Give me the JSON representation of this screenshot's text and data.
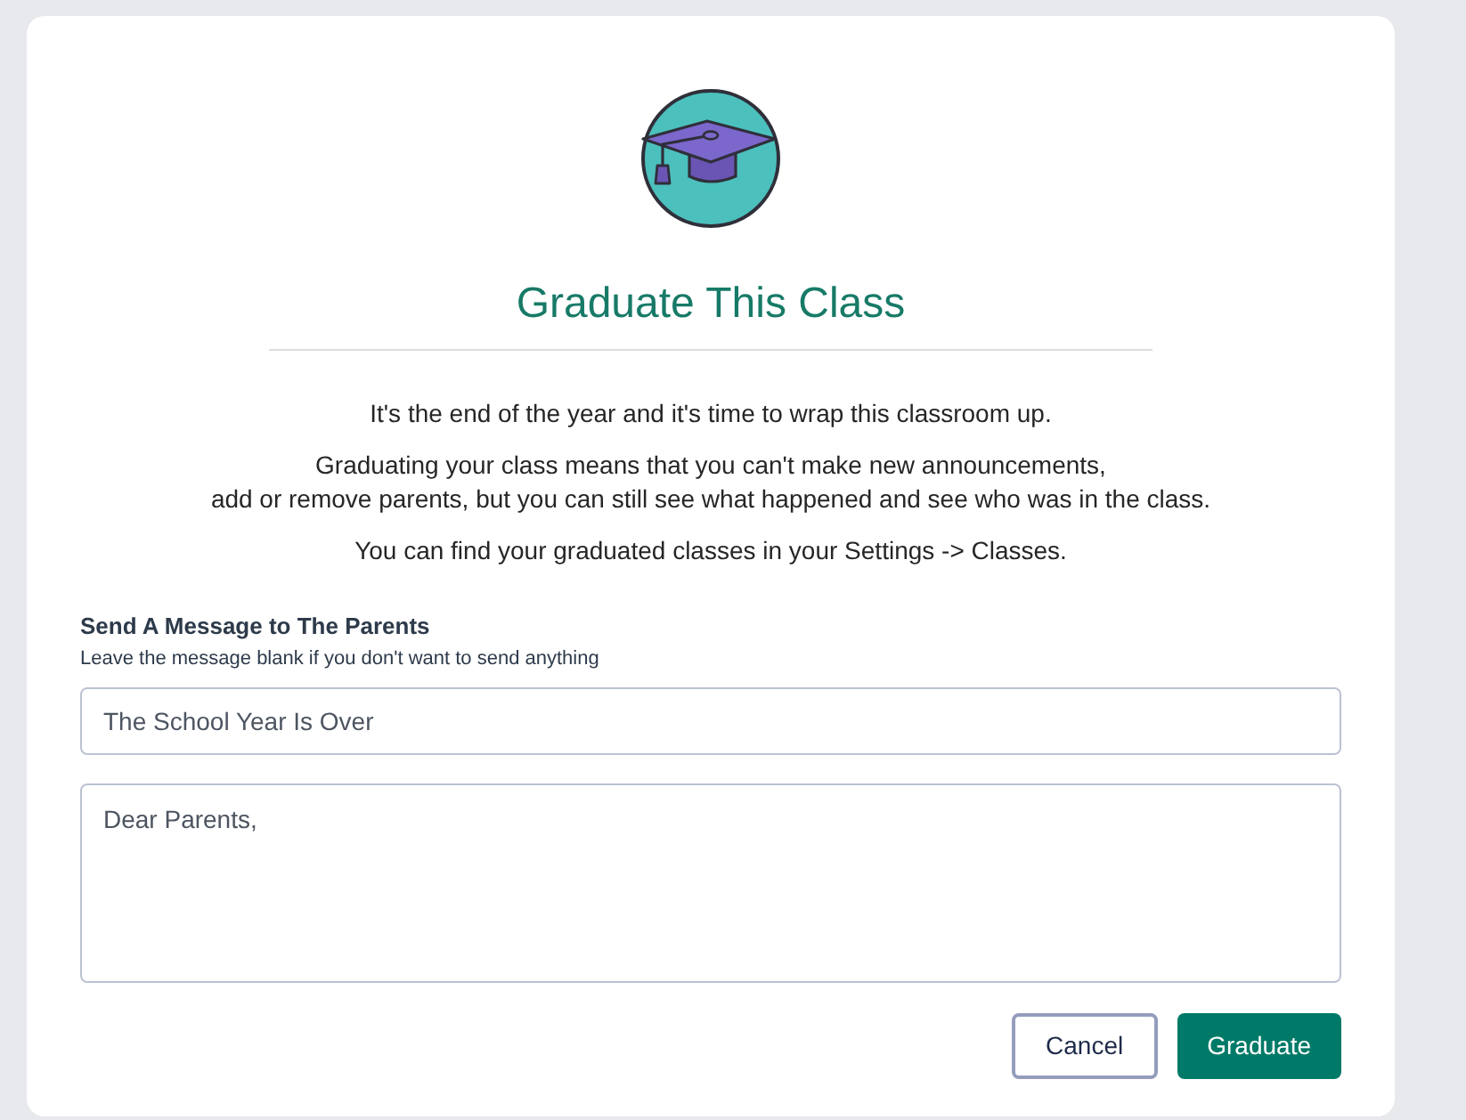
{
  "dialog": {
    "title": "Graduate This Class",
    "paragraphs": [
      [
        "It's the end of the year and it's time to wrap this classroom up."
      ],
      [
        "Graduating your class means that you can't make new announcements,",
        "add or remove parents, but you can still see what happened and see who was in the class."
      ],
      [
        "You can find your graduated classes in your Settings -> Classes."
      ]
    ],
    "message": {
      "label": "Send A Message to The Parents",
      "hint": "Leave the message blank if you don't want to send anything",
      "subject": {
        "value": "The School Year Is Over"
      },
      "body": {
        "value": "Dear Parents,"
      }
    },
    "buttons": [
      {
        "label": "Cancel",
        "kind": "secondary"
      },
      {
        "label": "Graduate",
        "kind": "primary"
      }
    ]
  }
}
